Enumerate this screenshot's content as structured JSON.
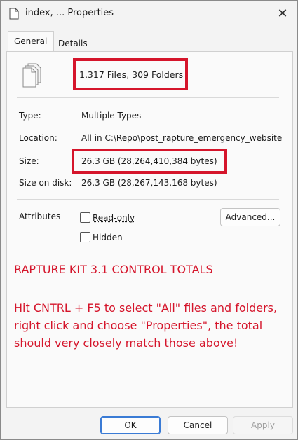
{
  "window": {
    "title": "index, ... Properties",
    "close_glyph": "✕"
  },
  "tabs": [
    {
      "label": "General",
      "active": true
    },
    {
      "label": "Details",
      "active": false
    }
  ],
  "summary": {
    "files_folders": "1,317 Files, 309 Folders"
  },
  "fields": {
    "type_label": "Type:",
    "type_value": "Multiple Types",
    "location_label": "Location:",
    "location_value": "All in C:\\Repo\\post_rapture_emergency_website_",
    "size_label": "Size:",
    "size_value": "26.3 GB (28,264,410,384 bytes)",
    "size_on_disk_label": "Size on disk:",
    "size_on_disk_value": "26.3 GB (28,267,143,168 bytes)"
  },
  "attributes": {
    "label": "Attributes",
    "readonly_label": "Read-only",
    "readonly_checked": false,
    "hidden_label": "Hidden",
    "hidden_checked": false,
    "advanced_label": "Advanced..."
  },
  "note": {
    "title": "RAPTURE KIT 3.1 CONTROL TOTALS",
    "lines": [
      "Hit CNTRL + F5 to select \"All\" files and folders,",
      "right click and choose \"Properties\", the total",
      "should very closely match those above!"
    ],
    "color": "#d5152b"
  },
  "footer": {
    "ok_label": "OK",
    "cancel_label": "Cancel",
    "apply_label": "Apply",
    "apply_enabled": false
  },
  "icons": {
    "title_icon": "document-icon",
    "multi_file_icon": "multiple-files-icon"
  },
  "colors": {
    "highlight": "#d5152b",
    "ok_border": "#3a7bd5"
  }
}
